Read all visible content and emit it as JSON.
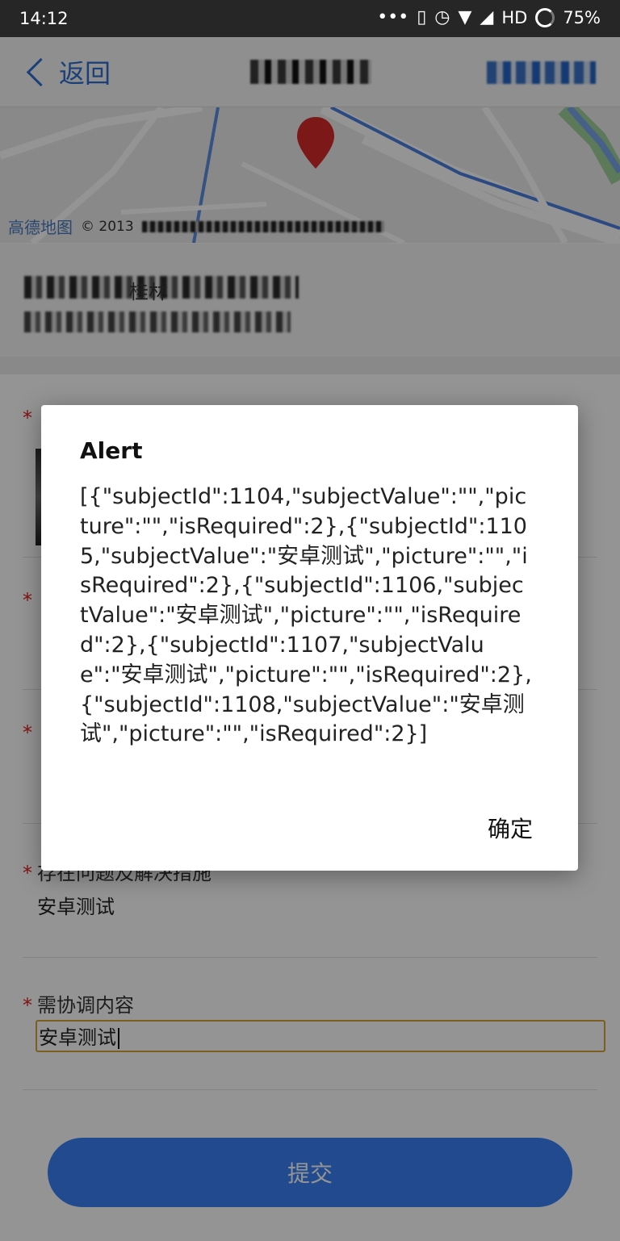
{
  "status_bar": {
    "time": "14:12",
    "network": "HD",
    "battery": "75%",
    "icons": [
      "more-dots-icon",
      "vibrate-icon",
      "alarm-icon",
      "wifi-icon",
      "signal-icon",
      "battery-icon"
    ]
  },
  "nav": {
    "back_label": "返回"
  },
  "map": {
    "provider": "高德地图",
    "copyright": "© 2013"
  },
  "address": {
    "partial_text": "桂林"
  },
  "form": {
    "fields": [
      {
        "label": "",
        "value": ""
      },
      {
        "label": "",
        "value": ""
      },
      {
        "label": "",
        "value": ""
      },
      {
        "label": "存在问题及解决措施",
        "value": "安卓测试"
      },
      {
        "label": "需协调内容",
        "value": "安卓测试"
      }
    ],
    "required_mark": "*",
    "submit_label": "提交"
  },
  "dialog": {
    "title": "Alert",
    "message": "[{\"subjectId\":1104,\"subjectValue\":\"\",\"picture\":\"\",\"isRequired\":2},{\"subjectId\":1105,\"subjectValue\":\"安卓测试\",\"picture\":\"\",\"isRequired\":2},{\"subjectId\":1106,\"subjectValue\":\"安卓测试\",\"picture\":\"\",\"isRequired\":2},{\"subjectId\":1107,\"subjectValue\":\"安卓测试\",\"picture\":\"\",\"isRequired\":2},{\"subjectId\":1108,\"subjectValue\":\"安卓测试\",\"picture\":\"\",\"isRequired\":2}]",
    "ok_label": "确定"
  },
  "colors": {
    "accent": "#3b82f6",
    "back_link": "#2f6fd1",
    "required": "#e02020",
    "input_focus_border": "#d8a33a",
    "status_bar_bg": "#262626"
  }
}
